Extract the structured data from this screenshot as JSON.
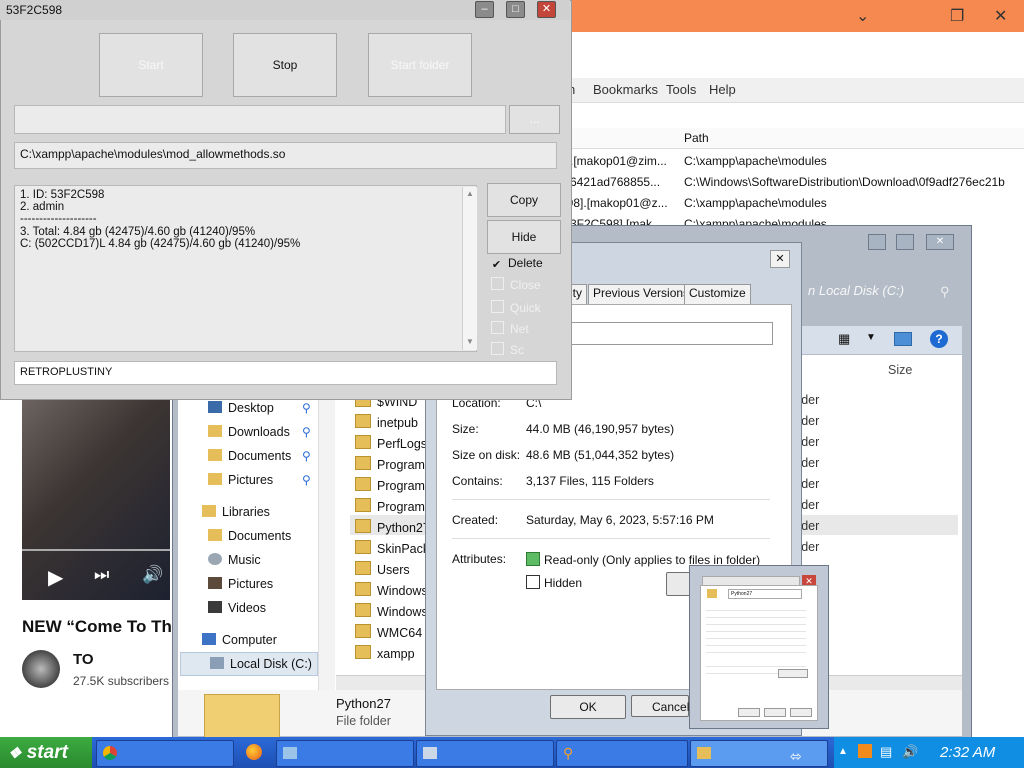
{
  "app": {
    "title": "53F2C598",
    "buttons": {
      "start": "Start",
      "stop": "Stop",
      "start_folder": "Start folder",
      "browse": "..."
    },
    "path_field": "C:\\xampp\\apache\\modules\\mod_allowmethods.so",
    "log_lines": [
      "1. ID: 53F2C598",
      "2. admin",
      "--------------------",
      "3. Total: 4.84 gb (42475)/4.60 gb (41240)/95%",
      "C: (502CCD17)L 4.84 gb (42475)/4.60 gb (41240)/95%"
    ],
    "side_buttons": {
      "copy": "Copy",
      "hide": "Hide"
    },
    "options": [
      {
        "label": "Delete",
        "checked": true,
        "enabled": true
      },
      {
        "label": "Close",
        "checked": false,
        "enabled": false
      },
      {
        "label": "Quick",
        "checked": false,
        "enabled": false
      },
      {
        "label": "Net",
        "checked": false,
        "enabled": false
      },
      {
        "label": "Sc",
        "checked": false,
        "enabled": false
      }
    ],
    "bottom_field": "RETROPLUSTINY"
  },
  "browser": {
    "menu": [
      "h",
      "Bookmarks",
      "Tools",
      "Help"
    ],
    "column_header": "Path",
    "rows": [
      {
        "name": "8].[makop01@zim...",
        "path": "C:\\xampp\\apache\\modules"
      },
      {
        "name": "af6421ad768855...",
        "path": "C:\\Windows\\SoftwareDistribution\\Download\\0f9adf276ec21b"
      },
      {
        "name": "598].[makop01@z...",
        "path": "C:\\xampp\\apache\\modules"
      },
      {
        "name": "[53F2C598].[mak...",
        "path": "C:\\xampp\\apache\\modules"
      }
    ]
  },
  "media": {
    "title": "NEW “Come To Th",
    "channel": "TO",
    "subscribers": "27.5K subscribers"
  },
  "explorer": {
    "location_title": "n Local Disk (C:)",
    "nav": [
      {
        "label": "Desktop",
        "type": "desktop"
      },
      {
        "label": "Downloads",
        "type": "downloads"
      },
      {
        "label": "Documents",
        "type": "documents"
      },
      {
        "label": "Pictures",
        "type": "pictures"
      },
      {
        "label": "Libraries",
        "type": "libraries"
      },
      {
        "label": "Documents",
        "type": "documents"
      },
      {
        "label": "Music",
        "type": "music"
      },
      {
        "label": "Pictures",
        "type": "pictures"
      },
      {
        "label": "Videos",
        "type": "videos"
      },
      {
        "label": "Computer",
        "type": "computer"
      },
      {
        "label": "Local Disk (C:)",
        "type": "disk"
      }
    ],
    "files": [
      "$WIND",
      "inetpub",
      "PerfLogs",
      "Program",
      "Program",
      "ProgramD",
      "Python27",
      "SkinPack",
      "Users",
      "Windows",
      "Windows",
      "WMC64",
      "xampp"
    ],
    "size_header": "Size",
    "type_column": [
      "folder",
      "folder",
      "folder",
      "folder",
      "folder",
      "folder",
      "folder",
      "folder"
    ],
    "details": {
      "name": "Python27",
      "type": "File folder"
    }
  },
  "properties": {
    "tabs": [
      "ity",
      "Previous Versions",
      "Customize"
    ],
    "location_label": "Location:",
    "location_value": "C:\\",
    "size_label": "Size:",
    "size_value": "44.0 MB (46,190,957 bytes)",
    "size_on_disk_label": "Size on disk:",
    "size_on_disk_value": "48.6 MB (51,044,352 bytes)",
    "contains_label": "Contains:",
    "contains_value": "3,137 Files, 115 Folders",
    "created_label": "Created:",
    "created_value": "Saturday, May 6, 2023, 5:57:16 PM",
    "attributes_label": "Attributes:",
    "readonly_label": "Read-only (Only applies to files in folder)",
    "hidden_label": "Hidden",
    "ok": "OK",
    "cancel": "Cancel"
  },
  "thumbnail": {
    "name": "Python27"
  },
  "taskbar": {
    "start": "start",
    "clock": "2:32 AM"
  }
}
